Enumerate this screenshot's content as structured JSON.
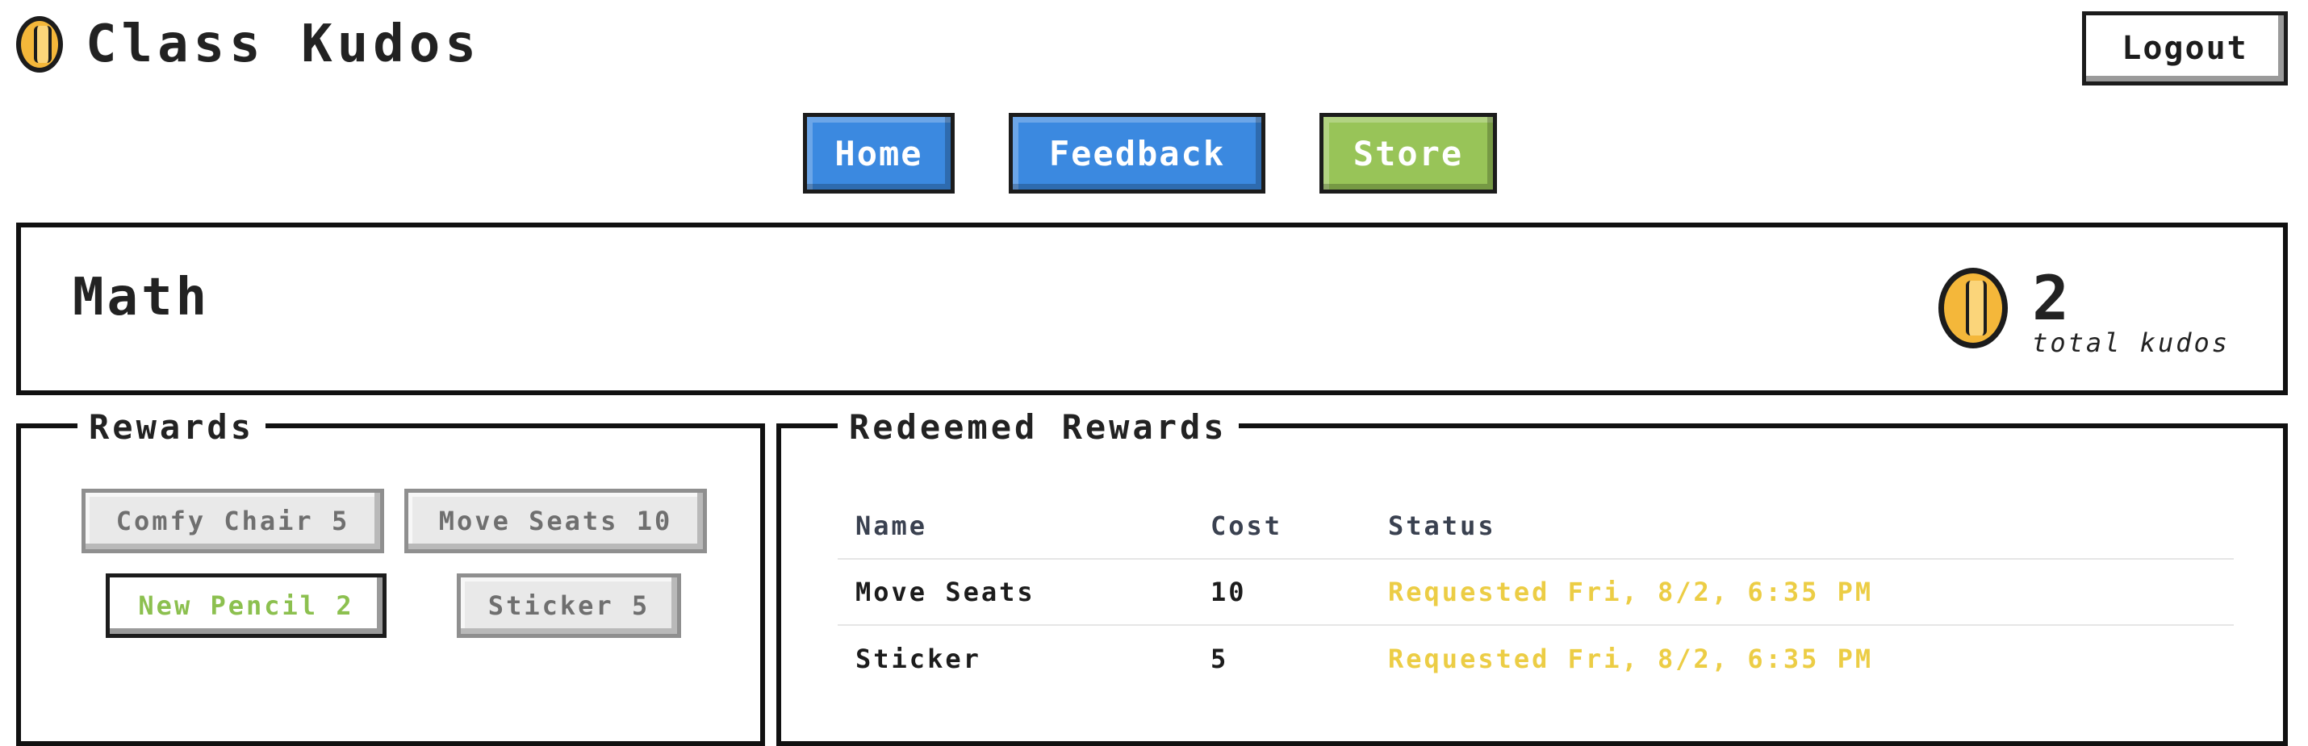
{
  "header": {
    "title": "Class Kudos",
    "logo_icon": "coin-icon",
    "logout_label": "Logout"
  },
  "nav": {
    "items": [
      {
        "label": "Home",
        "color": "#3b89e0"
      },
      {
        "label": "Feedback",
        "color": "#3b89e0"
      },
      {
        "label": "Store",
        "color": "#98c458",
        "active": true
      }
    ]
  },
  "class_panel": {
    "class_name": "Math",
    "kudos_total": "2",
    "kudos_label": "total kudos",
    "kudos_icon": "coin-icon"
  },
  "rewards": {
    "legend": "Rewards",
    "items": [
      {
        "label": "Comfy Chair 5",
        "available": false
      },
      {
        "label": "Move Seats 10",
        "available": false
      },
      {
        "label": "New Pencil 2",
        "available": true
      },
      {
        "label": "Sticker 5",
        "available": false
      }
    ]
  },
  "redeemed": {
    "legend": "Redeemed Rewards",
    "columns": [
      "Name",
      "Cost",
      "Status"
    ],
    "rows": [
      {
        "name": "Move Seats",
        "cost": "10",
        "status": "Requested Fri, 8/2, 6:35 PM"
      },
      {
        "name": "Sticker",
        "cost": "5",
        "status": "Requested Fri, 8/2, 6:35 PM"
      }
    ]
  },
  "colors": {
    "accent_blue": "#3b89e0",
    "accent_green": "#98c458",
    "coin_gold": "#f4b73a",
    "status_pending": "#eccd45"
  }
}
